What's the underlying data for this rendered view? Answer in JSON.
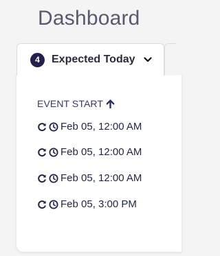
{
  "page": {
    "title": "Dashboard"
  },
  "tabs": [
    {
      "count": "4",
      "label": "Expected Today"
    }
  ],
  "table": {
    "column_header": "EVENT START",
    "sort_icon": "arrow-up-icon",
    "row_icons": [
      "refresh-icon",
      "clock-icon"
    ],
    "rows": [
      {
        "event_start": "Feb 05, 12:00 AM"
      },
      {
        "event_start": "Feb 05, 12:00 AM"
      },
      {
        "event_start": "Feb 05, 12:00 AM"
      },
      {
        "event_start": "Feb 05, 3:00 PM"
      }
    ]
  },
  "colors": {
    "badge": "#24204a",
    "text_primary": "#1f2440",
    "title": "#575a6b"
  }
}
